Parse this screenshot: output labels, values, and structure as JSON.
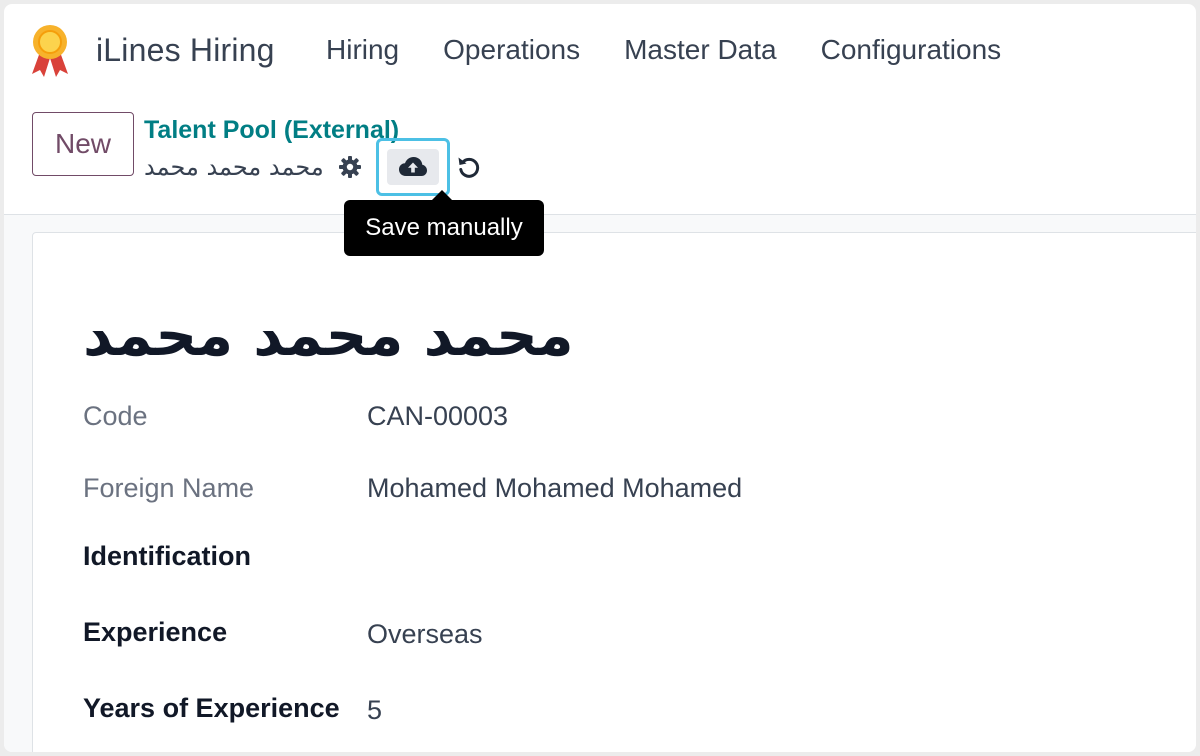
{
  "navbar": {
    "app_name": "iLines Hiring",
    "menu": [
      {
        "label": "Hiring"
      },
      {
        "label": "Operations"
      },
      {
        "label": "Master Data"
      },
      {
        "label": "Configurations"
      }
    ]
  },
  "control_panel": {
    "new_label": "New",
    "breadcrumb": "Talent Pool (External)",
    "record_name": "محمد محمد محمد",
    "tooltip": "Save manually"
  },
  "form": {
    "title": "محمد محمد محمد",
    "fields": [
      {
        "label": "Code",
        "value": "CAN-00003"
      },
      {
        "label": "Foreign Name",
        "value": "Mohamed Mohamed Mohamed"
      },
      {
        "label": "Identification",
        "value": ""
      },
      {
        "label": "Experience",
        "value": "Overseas"
      },
      {
        "label": "Years of Experience",
        "value": "5"
      }
    ]
  },
  "colors": {
    "accent": "#714b67",
    "breadcrumb": "#017e84",
    "highlight": "#4cc0e5"
  }
}
